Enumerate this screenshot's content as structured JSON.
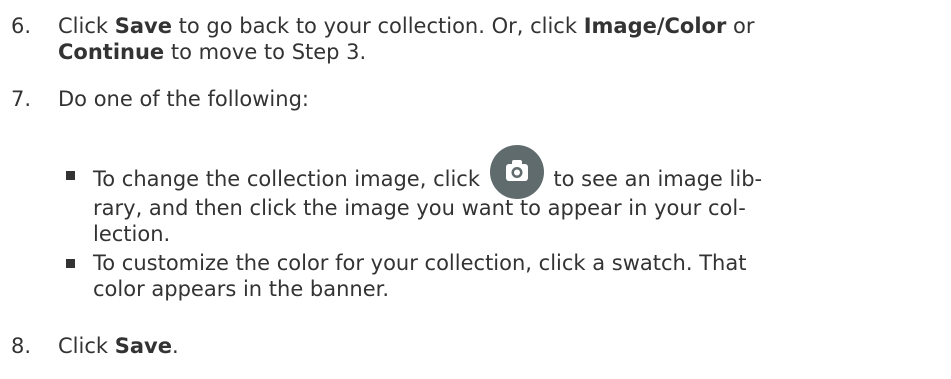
{
  "steps": [
    {
      "number": "6.",
      "line1_pre": "Click ",
      "line1_save": "Save",
      "line1_mid": " to go back to your collection. Or, click ",
      "line1_image_color": "Image/Color",
      "line1_post": " or",
      "line2_continue": "Continue",
      "line2_post": " to move to Step 3."
    },
    {
      "number": "7.",
      "text": "Do one of the following:"
    },
    {
      "number": "8.",
      "pre": "Click ",
      "save": "Save",
      "post": "."
    }
  ],
  "bullets": [
    {
      "line1_pre": "To change the collection image, click",
      "line1_post": "to see an image lib-",
      "line2": "rary, and then click the image you want to appear in your col-",
      "line3": "lection.",
      "icon": "camera-icon"
    },
    {
      "line1": "To customize the color for your collection, click a swatch. That",
      "line2": "color appears in the banner."
    }
  ],
  "colors": {
    "text": "#333333",
    "icon_background": "#5f6b6d",
    "icon_glyph": "#ffffff"
  }
}
